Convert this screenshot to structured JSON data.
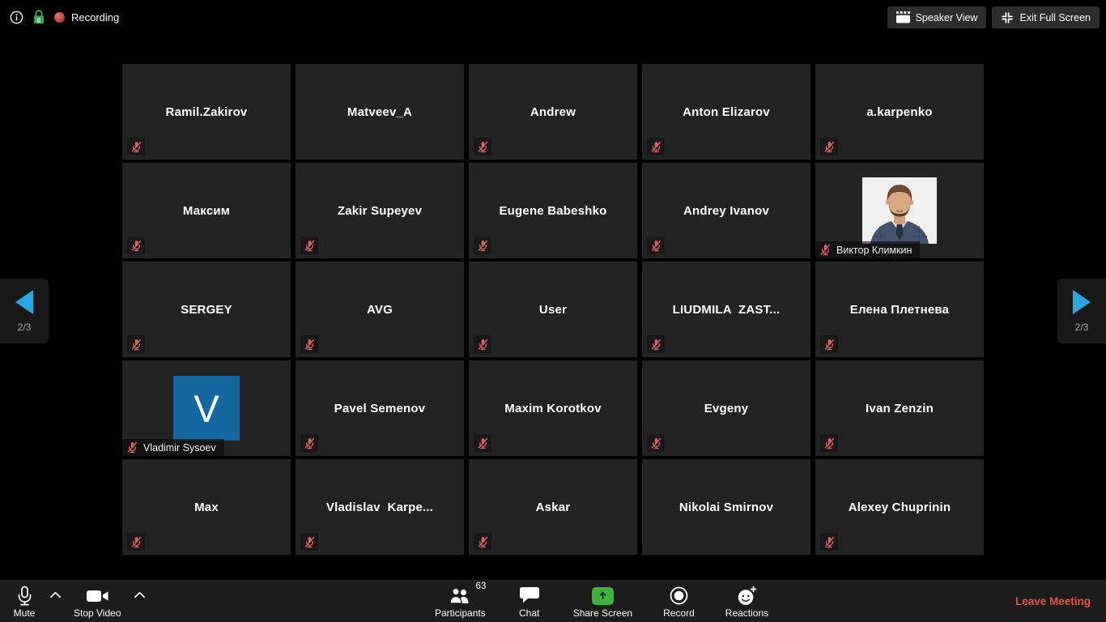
{
  "top_bar": {
    "info_icon": "info-icon",
    "encryption_icon": "encryption-lock-icon",
    "recording": {
      "dot_icon": "recording-dot",
      "label": "Recording"
    },
    "speaker_view_button": {
      "icon": "gallery-grid-icon",
      "label": "Speaker View"
    },
    "exit_full_screen_button": {
      "icon": "collapse-arrows-icon",
      "label": "Exit Full Screen"
    }
  },
  "pagination": {
    "previous": {
      "icon": "left-triangle-arrow-icon",
      "page": "2/3"
    },
    "next": {
      "icon": "right-triangle-arrow-icon",
      "page": "2/3"
    }
  },
  "grid": {
    "tiles": [
      {
        "name": "Ramil.Zakirov",
        "muted": true,
        "display": "name"
      },
      {
        "name": "Matveev_A",
        "muted": false,
        "display": "name"
      },
      {
        "name": "Andrew",
        "muted": true,
        "display": "name"
      },
      {
        "name": "Anton Elizarov",
        "muted": true,
        "display": "name"
      },
      {
        "name": "a.karpenko",
        "muted": true,
        "display": "name"
      },
      {
        "name": "Максим",
        "muted": true,
        "display": "name"
      },
      {
        "name": "Zakir Supeyev",
        "muted": true,
        "display": "name"
      },
      {
        "name": "Eugene Babeshko",
        "muted": true,
        "display": "name"
      },
      {
        "name": "Andrey Ivanov",
        "muted": true,
        "display": "name"
      },
      {
        "name": "Виктор Климкин",
        "muted": true,
        "display": "photo"
      },
      {
        "name": "SERGEY",
        "muted": true,
        "display": "name"
      },
      {
        "name": "AVG",
        "muted": true,
        "display": "name"
      },
      {
        "name": "User",
        "muted": true,
        "display": "name"
      },
      {
        "name": "LIUDMILA  ZAST...",
        "muted": true,
        "display": "name"
      },
      {
        "name": "Елена Плетнева",
        "muted": true,
        "display": "name"
      },
      {
        "name": "Vladimir Sysoev",
        "muted": true,
        "display": "avatar",
        "avatar_letter": "V"
      },
      {
        "name": "Pavel Semenov",
        "muted": true,
        "display": "name"
      },
      {
        "name": "Maxim Korotkov",
        "muted": true,
        "display": "name"
      },
      {
        "name": "Evgeny",
        "muted": true,
        "display": "name"
      },
      {
        "name": "Ivan Zenzin",
        "muted": true,
        "display": "name"
      },
      {
        "name": "Max",
        "muted": true,
        "display": "name"
      },
      {
        "name": "Vladislav  Karpe...",
        "muted": true,
        "display": "name"
      },
      {
        "name": "Askar",
        "muted": true,
        "display": "name"
      },
      {
        "name": "Nikolai Smirnov",
        "muted": false,
        "display": "name"
      },
      {
        "name": "Alexey Chuprinin",
        "muted": true,
        "display": "name"
      }
    ]
  },
  "toolbar": {
    "mute": {
      "icon": "microphone-icon",
      "label": "Mute",
      "menu_icon": "chevron-up-icon"
    },
    "stop_video": {
      "icon": "video-camera-icon",
      "label": "Stop Video",
      "menu_icon": "chevron-up-icon"
    },
    "participants": {
      "icon": "participants-icon",
      "label": "Participants",
      "count": "63"
    },
    "chat": {
      "icon": "chat-bubble-icon",
      "label": "Chat"
    },
    "share_screen": {
      "icon": "share-screen-icon",
      "label": "Share Screen"
    },
    "record": {
      "icon": "record-icon",
      "label": "Record"
    },
    "reactions": {
      "icon": "reactions-smiley-icon",
      "label": "Reactions"
    },
    "leave": {
      "label": "Leave Meeting"
    }
  },
  "colors": {
    "accent_blue": "#2aa7e0",
    "avatar_blue": "#1467a0",
    "muted_mic_red": "#e0615e",
    "share_screen_green": "#3eb23e",
    "leave_meeting_red": "#e8504a",
    "recording_red": "#c04339",
    "encryption_green": "#33a852",
    "tile_background": "#232323",
    "toolbar_background": "#1c1c1c"
  }
}
